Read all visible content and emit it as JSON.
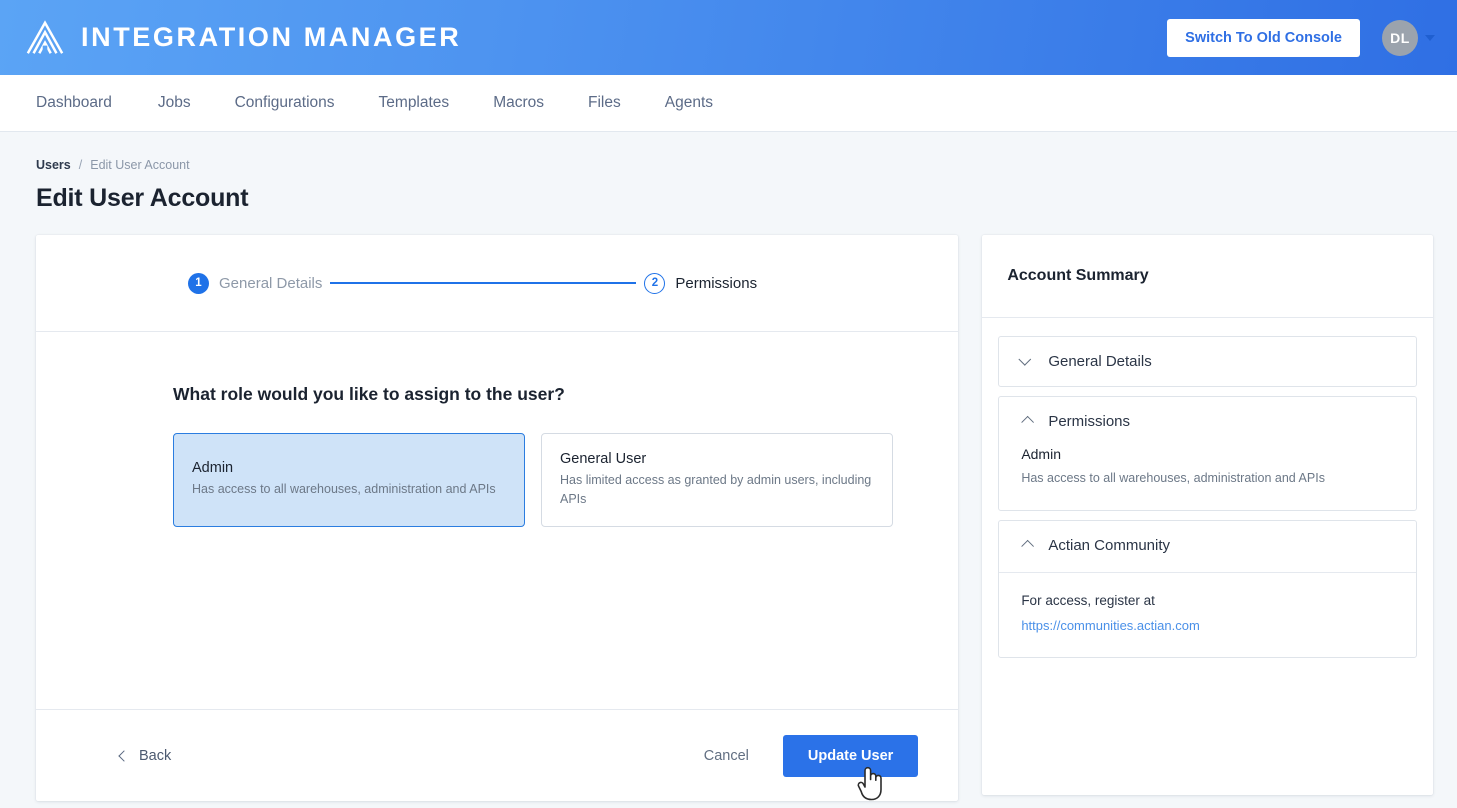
{
  "header": {
    "brand_title": "INTEGRATION MANAGER",
    "logo_icon": "actian-triangle-logo-icon",
    "switch_console_label": "Switch To Old Console",
    "avatar_initials": "DL",
    "avatar_caret_icon": "chevron-down-icon",
    "brand_gradient_from": "#5ba4f5",
    "brand_gradient_to": "#2f6fe4"
  },
  "nav": {
    "items": [
      {
        "label": "Dashboard"
      },
      {
        "label": "Jobs"
      },
      {
        "label": "Configurations"
      },
      {
        "label": "Templates"
      },
      {
        "label": "Macros"
      },
      {
        "label": "Files"
      },
      {
        "label": "Agents"
      }
    ]
  },
  "breadcrumb": {
    "parent": "Users",
    "separator": "/",
    "current": "Edit User Account"
  },
  "page": {
    "title": "Edit User Account"
  },
  "wizard": {
    "steps": [
      {
        "number": "1",
        "label": "General Details",
        "state": "done"
      },
      {
        "number": "2",
        "label": "Permissions",
        "state": "current"
      }
    ],
    "question": "What role would you like to assign to the user?",
    "roles": [
      {
        "name": "Admin",
        "description": "Has access to all warehouses, administration and APIs",
        "selected": true
      },
      {
        "name": "General User",
        "description": "Has limited access as granted by admin users, including APIs",
        "selected": false
      }
    ],
    "footer": {
      "back_label": "Back",
      "back_icon": "chevron-left-icon",
      "cancel_label": "Cancel",
      "submit_label": "Update User"
    },
    "accent_color": "#2b72e8",
    "selected_card_bg": "#cfe3f8",
    "selected_card_border": "#2b7de0"
  },
  "summary": {
    "title": "Account Summary",
    "sections": [
      {
        "label": "General Details",
        "icon": "chevron-down-icon",
        "expanded": false
      },
      {
        "label": "Permissions",
        "icon": "chevron-up-icon",
        "expanded": true,
        "role_name": "Admin",
        "role_description": "Has access to all warehouses, administration and APIs"
      },
      {
        "label": "Actian Community",
        "icon": "chevron-up-icon",
        "expanded": true,
        "text": "For access, register at",
        "link": "https://communities.actian.com",
        "link_color": "#4a90e8"
      }
    ]
  },
  "cursor": {
    "type": "pointer-hand"
  }
}
